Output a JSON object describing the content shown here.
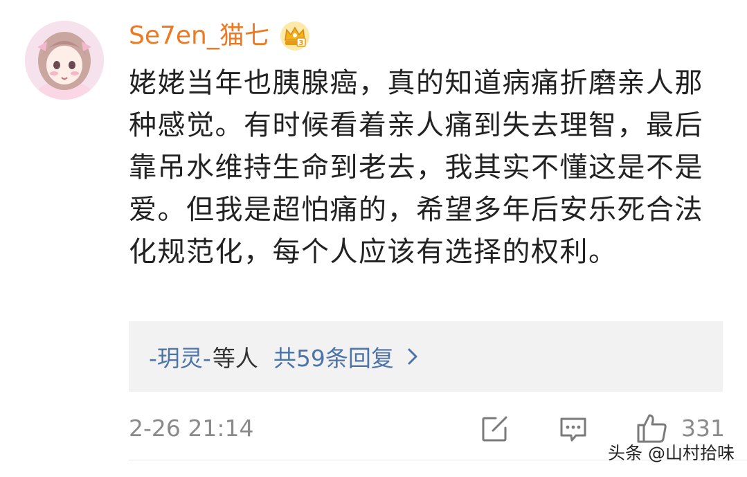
{
  "comment": {
    "author": {
      "username": "Se7en_猫七",
      "avatar_icon": "anime-girl-avatar",
      "badge_icon": "crown-badge-icon"
    },
    "text": "姥姥当年也胰腺癌，真的知道病痛折磨亲人那种感觉。有时候看着亲人痛到失去理智，最后靠吊水维持生命到老去，我其实不懂这是不是爱。但我是超怕痛的，希望多年后安乐死合法化规范化，每个人应该有选择的权利。",
    "replies": {
      "user": "-玥灵-",
      "suffix": "等人",
      "count_label": "共59条回复"
    },
    "timestamp": "2-26 21:14",
    "actions": {
      "share_icon": "share-icon",
      "reply_icon": "comment-icon",
      "like_icon": "thumbs-up-icon",
      "like_count": "331"
    }
  },
  "watermark": "头条 @山村拾味",
  "colors": {
    "username": "#f0781e",
    "reply_link": "#4d74a8",
    "body_text": "#222222",
    "muted": "#8a8a8a",
    "reply_box_bg": "#f2f2f2"
  }
}
